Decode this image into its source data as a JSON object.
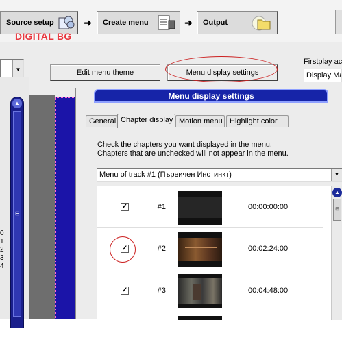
{
  "workflow": {
    "steps": [
      {
        "label": "Source setup"
      },
      {
        "label": "Create menu"
      },
      {
        "label": "Output"
      }
    ],
    "arrow": "➜"
  },
  "watermark": "DIGITAL BG",
  "toolbar": {
    "edit_menu_theme": "Edit menu theme",
    "menu_display_settings": "Menu display settings",
    "firstplay_label": "Firstplay act",
    "firstplay_value": "Display Ma"
  },
  "left_pane": {
    "numbers": [
      "0",
      "1",
      "2",
      "3",
      "4"
    ]
  },
  "dialog": {
    "title": "Menu display settings",
    "tabs": [
      "General",
      "Chapter display",
      "Motion menu",
      "Highlight color"
    ],
    "active_tab": "Chapter display",
    "instructions": [
      "Check the chapters you want displayed in the menu.",
      "Chapters that are unchecked will not appear in the menu."
    ],
    "track_select": "Menu of track #1 (Първичен Инстинкт)",
    "chapters": [
      {
        "checked": true,
        "number": "#1",
        "time": "00:00:00:00"
      },
      {
        "checked": true,
        "number": "#2",
        "time": "00:02:24:00"
      },
      {
        "checked": true,
        "number": "#3",
        "time": "00:04:48:00"
      }
    ]
  },
  "colors": {
    "dialog_title_bg": "#1624a8",
    "highlight_oval": "#cc2020",
    "watermark": "#e8383f"
  }
}
